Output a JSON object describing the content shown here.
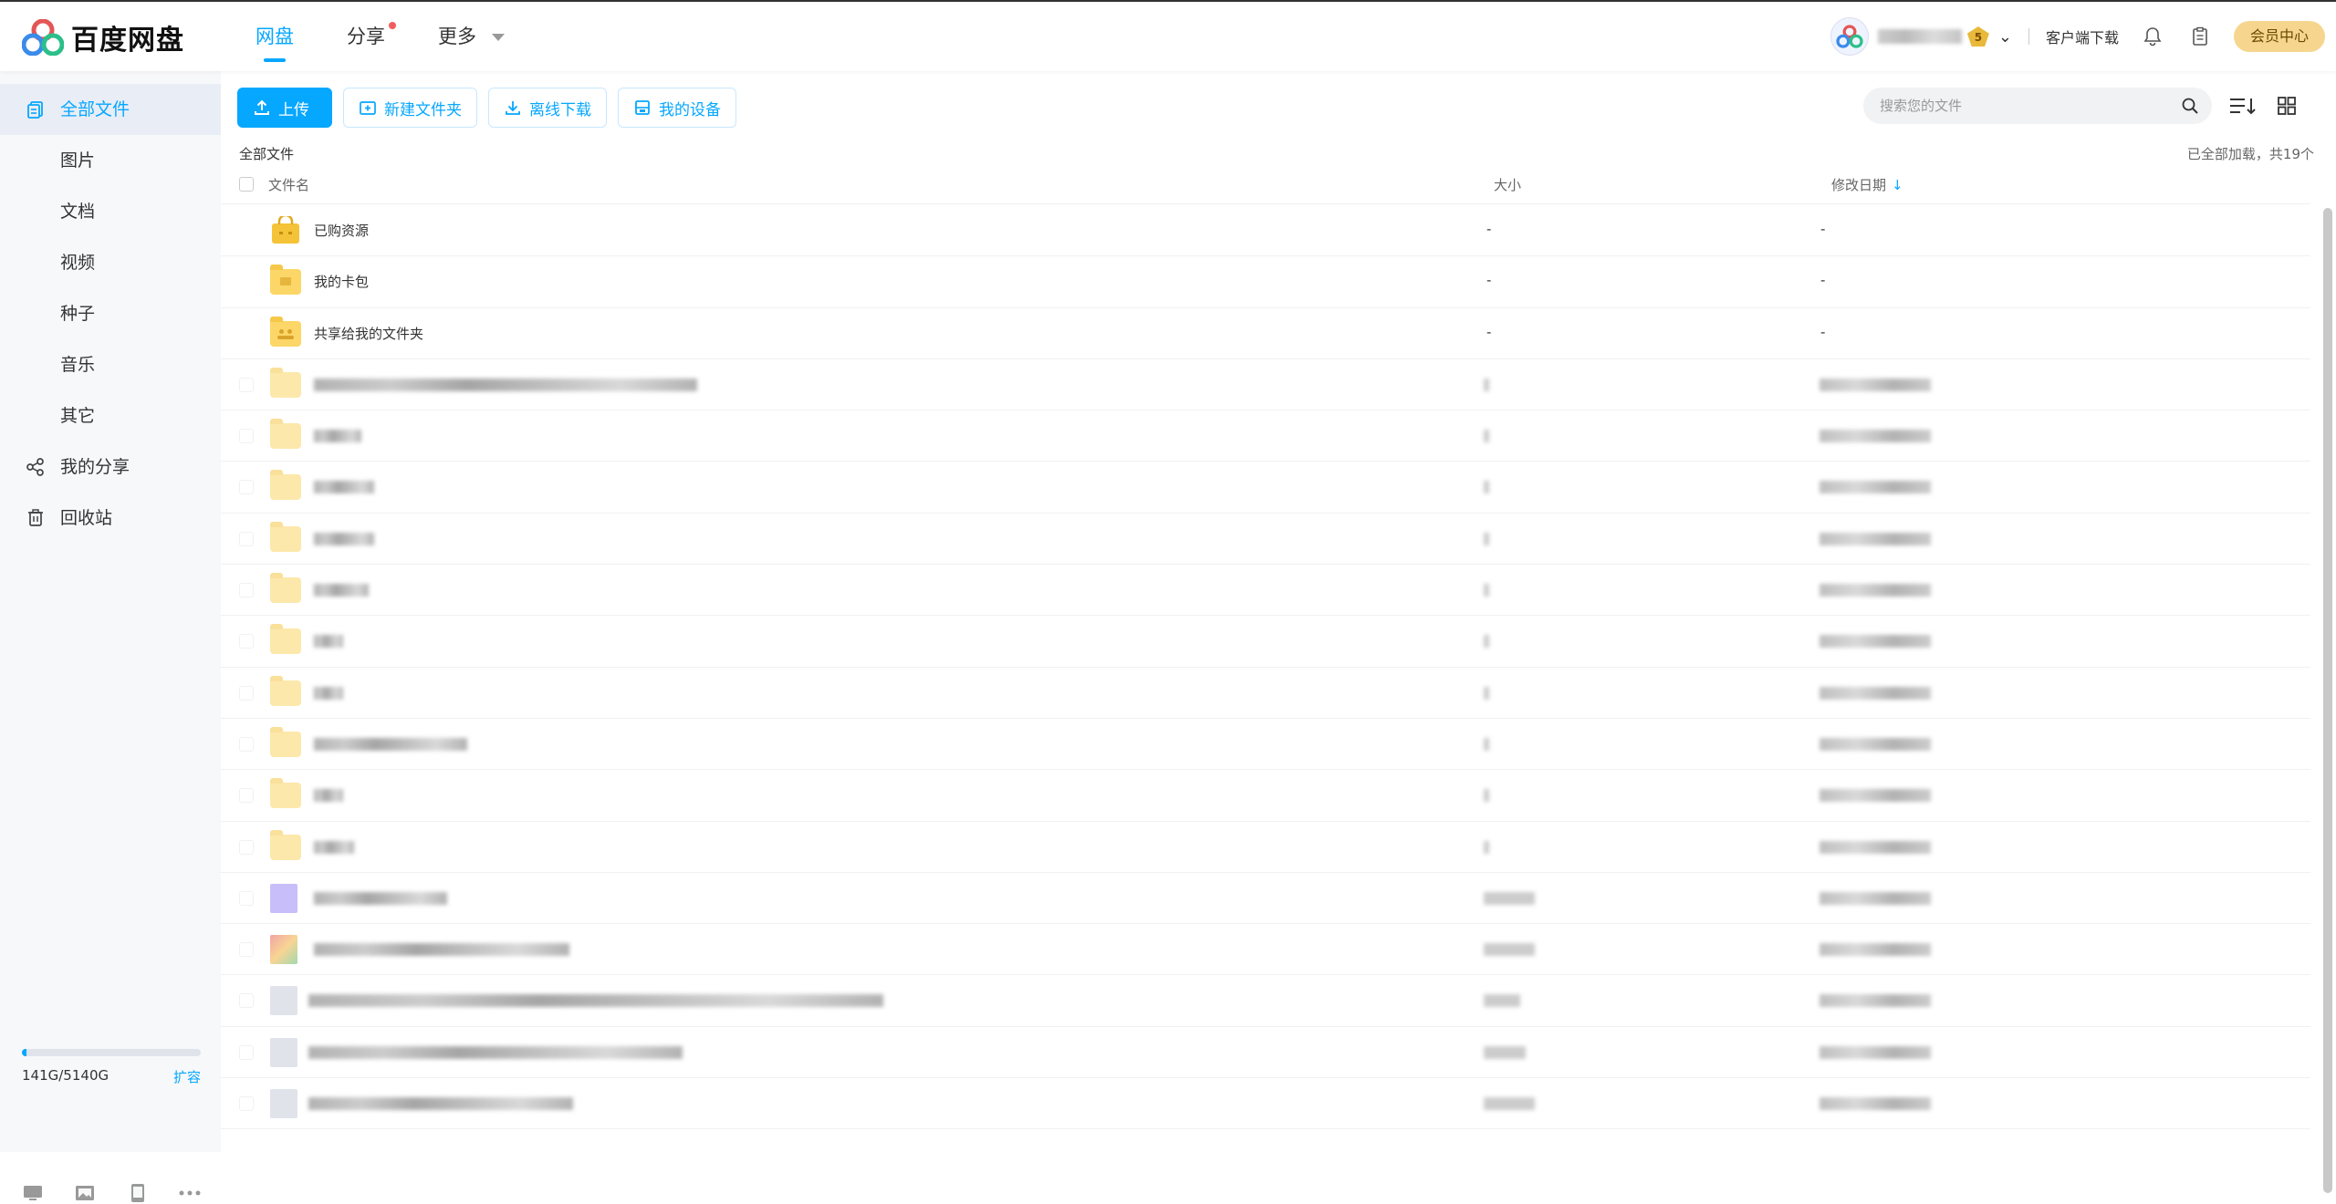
{
  "app": {
    "logo_text": "百度网盘"
  },
  "nav": [
    {
      "label": "网盘",
      "active": true
    },
    {
      "label": "分享",
      "dot": true
    },
    {
      "label": "更多",
      "caret": true
    }
  ],
  "header": {
    "vip_level": "5",
    "client_download": "客户端下载",
    "vip_center": "会员中心"
  },
  "sidebar": {
    "items": [
      {
        "label": "全部文件",
        "active": true,
        "icon": "files-icon"
      },
      {
        "label": "图片"
      },
      {
        "label": "文档"
      },
      {
        "label": "视频"
      },
      {
        "label": "种子"
      },
      {
        "label": "音乐"
      },
      {
        "label": "其它"
      },
      {
        "label": "我的分享",
        "icon": "share-icon"
      },
      {
        "label": "回收站",
        "icon": "trash-icon"
      }
    ],
    "storage": {
      "used_text": "141G/5140G",
      "used_fraction": 0.027,
      "expand_label": "扩容"
    }
  },
  "toolbar": {
    "upload": "上传",
    "new_folder": "新建文件夹",
    "offline_download": "离线下载",
    "my_devices": "我的设备"
  },
  "search": {
    "placeholder": "搜索您的文件"
  },
  "breadcrumb": "全部文件",
  "loaded_status": "已全部加载，共19个",
  "table": {
    "headers": {
      "name": "文件名",
      "size": "大小",
      "date": "修改日期"
    },
    "rows": [
      {
        "name": "已购资源",
        "size": "-",
        "date": "-",
        "icon": "purchased-folder-icon"
      },
      {
        "name": "我的卡包",
        "size": "-",
        "date": "-",
        "icon": "card-folder-icon"
      },
      {
        "name": "共享给我的文件夹",
        "size": "-",
        "date": "-",
        "icon": "shared-folder-icon"
      }
    ]
  },
  "colors": {
    "accent": "#06a7ff",
    "folder": "#fcd667",
    "vip": "#f6d68e"
  }
}
